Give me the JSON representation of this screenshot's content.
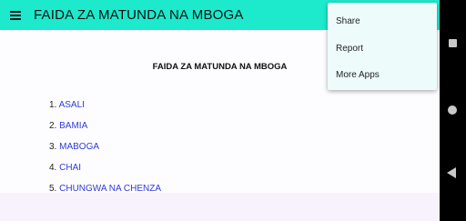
{
  "appbar": {
    "title": "FAIDA ZA MATUNDA NA MBOGA",
    "menu_icon": "hamburger-menu-icon",
    "color": "#1de9cc"
  },
  "content": {
    "title": "FAIDA ZA MATUNDA NA MBOGA",
    "items": [
      {
        "num": "1.",
        "label": "ASALI"
      },
      {
        "num": "2.",
        "label": "BAMIA"
      },
      {
        "num": "3.",
        "label": "MABOGA"
      },
      {
        "num": "4.",
        "label": "CHAI"
      },
      {
        "num": "5.",
        "label": "CHUNGWA NA CHENZA"
      }
    ],
    "link_color": "#2e3cd9"
  },
  "overflow_menu": {
    "items": [
      "Share",
      "Report",
      "More Apps"
    ]
  },
  "navigation_bar": {
    "icons": [
      "recents-square-icon",
      "home-circle-icon",
      "back-triangle-icon"
    ]
  }
}
